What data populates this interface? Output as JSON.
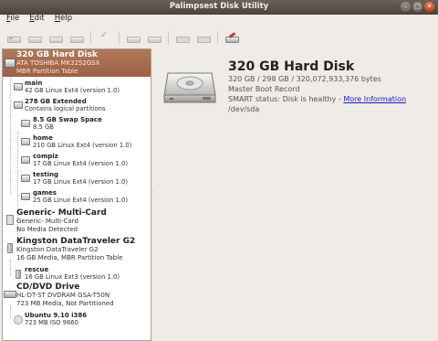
{
  "window": {
    "title": "Palimpsest Disk Utility"
  },
  "menu": [
    {
      "key": "file",
      "accel": "F",
      "rest": "ile"
    },
    {
      "key": "edit",
      "accel": "E",
      "rest": "dit"
    },
    {
      "key": "help",
      "accel": "H",
      "rest": "elp"
    }
  ],
  "toolbar": [
    "mount-icon",
    "unmount-icon",
    "eject-icon",
    "detach-icon",
    "check-icon",
    "format-icon",
    "create-icon",
    "delete-icon",
    "start-icon",
    "stop-icon",
    "edit-icon"
  ],
  "devices": {
    "hdd": {
      "name": "320 GB Hard Disk",
      "model": "ATA TOSHIBA MK3252GSX",
      "table": "MBR Partition Table"
    },
    "main": {
      "name": "main",
      "desc": "42 GB Linux Ext4 (version 1.0)"
    },
    "extended": {
      "name": "278 GB Extended",
      "desc": "Contains logical partitions"
    },
    "swap": {
      "name": "8.5 GB Swap Space",
      "desc": "8.5 GB"
    },
    "home": {
      "name": "home",
      "desc": "210 GB Linux Ext4 (version 1.0)"
    },
    "compiz": {
      "name": "compiz",
      "desc": "17 GB Linux Ext4 (version 1.0)"
    },
    "testing": {
      "name": "testing",
      "desc": "17 GB Linux Ext4 (version 1.0)"
    },
    "games": {
      "name": "games",
      "desc": "25 GB Linux Ext4 (version 1.0)"
    },
    "card": {
      "name": "Generic- Multi-Card",
      "model": "Generic- Multi-Card",
      "media": "No Media Detected"
    },
    "usb": {
      "name": "Kingston DataTraveler G2",
      "model": "Kingston DataTraveler G2",
      "media": "16 GB Media, MBR Partition Table"
    },
    "rescue": {
      "name": "rescue",
      "desc": "16 GB Linux Ext3 (version 1.0)"
    },
    "dvd": {
      "name": "CD/DVD Drive",
      "model": "HL-DT-ST DVDRAM GSA-T50N",
      "media": "723 MB Media, Not Partitioned"
    },
    "ubuntu": {
      "name": "Ubuntu 9.10 i386",
      "desc": "723 MB ISO 9660"
    }
  },
  "detail": {
    "title": "320 GB Hard Disk",
    "size": "320 GB / 298 GB / 320,072,933,376 bytes",
    "table": "Master Boot Record",
    "smart_prefix": "SMART status: Disk is healthy - ",
    "smart_link": "More Information",
    "device": "/dev/sda"
  }
}
